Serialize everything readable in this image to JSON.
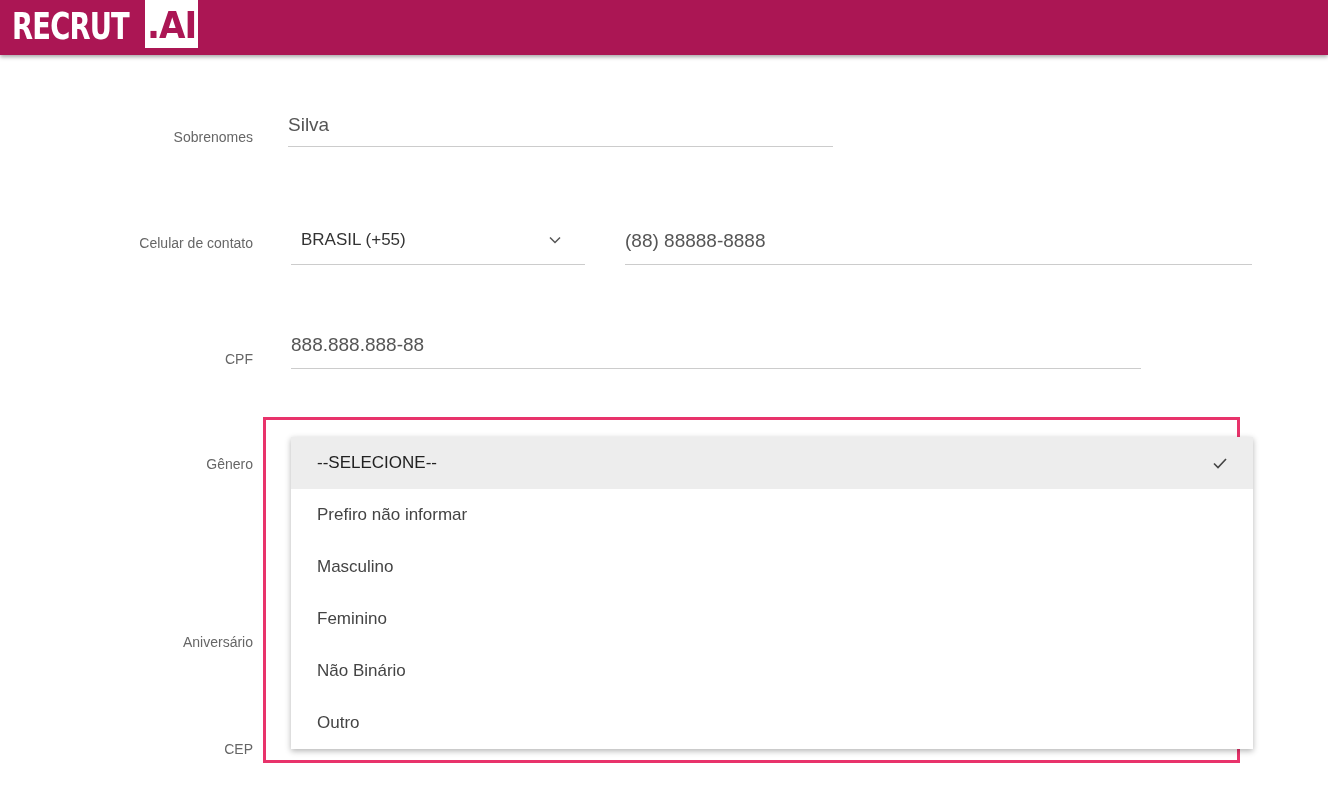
{
  "header": {
    "logo_text": "RECRUT",
    "logo_suffix": ".AI"
  },
  "rows": [
    {
      "label": "Sobrenomes",
      "kind": "text",
      "value": "Silva"
    },
    {
      "label": "Celular de contato",
      "kind": "phone",
      "country": "BRASIL (+55)",
      "value": "(88) 88888-8888"
    },
    {
      "label": "CPF",
      "kind": "text",
      "value": "888.888.888-88"
    },
    {
      "label": "Gênero",
      "kind": "select",
      "highlighted": true,
      "options": [
        {
          "label": "--SELECIONE--",
          "selected": true
        },
        {
          "label": "Prefiro não informar",
          "selected": false
        },
        {
          "label": "Masculino",
          "selected": false
        },
        {
          "label": "Feminino",
          "selected": false
        },
        {
          "label": "Não Binário",
          "selected": false
        },
        {
          "label": "Outro",
          "selected": false
        }
      ]
    },
    {
      "label": "Aniversário",
      "kind": "label"
    },
    {
      "label": "CEP",
      "kind": "label"
    }
  ]
}
